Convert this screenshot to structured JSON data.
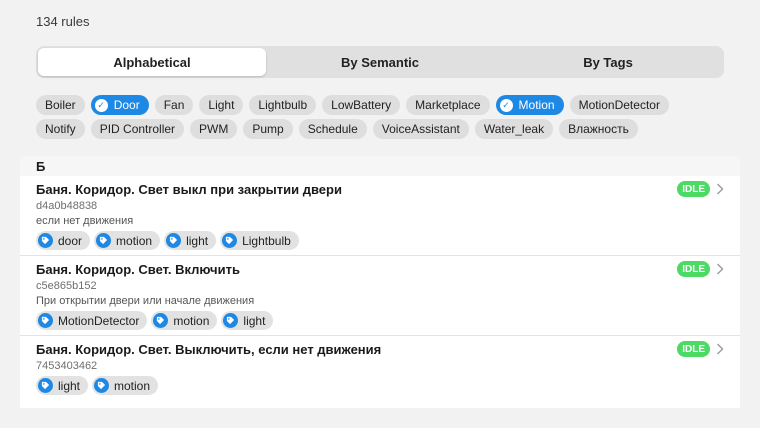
{
  "header": {
    "rule_count": "134 rules"
  },
  "segments": [
    {
      "label": "Alphabetical",
      "active": true
    },
    {
      "label": "By Semantic",
      "active": false
    },
    {
      "label": "By Tags",
      "active": false
    }
  ],
  "filter_chips": [
    {
      "label": "Boiler",
      "selected": false
    },
    {
      "label": "Door",
      "selected": true
    },
    {
      "label": "Fan",
      "selected": false
    },
    {
      "label": "Light",
      "selected": false
    },
    {
      "label": "Lightbulb",
      "selected": false
    },
    {
      "label": "LowBattery",
      "selected": false
    },
    {
      "label": "Marketplace",
      "selected": false
    },
    {
      "label": "Motion",
      "selected": true
    },
    {
      "label": "MotionDetector",
      "selected": false
    },
    {
      "label": "Notify",
      "selected": false
    },
    {
      "label": "PID Controller",
      "selected": false
    },
    {
      "label": "PWM",
      "selected": false
    },
    {
      "label": "Pump",
      "selected": false
    },
    {
      "label": "Schedule",
      "selected": false
    },
    {
      "label": "VoiceAssistant",
      "selected": false
    },
    {
      "label": "Water_leak",
      "selected": false
    },
    {
      "label": "Влажность",
      "selected": false
    }
  ],
  "section": {
    "letter": "Б"
  },
  "rules": [
    {
      "title": "Баня. Коридор. Свет выкл при закрытии двери",
      "id": "d4a0b48838",
      "description": "если нет движения",
      "tags": [
        "door",
        "motion",
        "light",
        "Lightbulb"
      ],
      "status": "IDLE"
    },
    {
      "title": "Баня. Коридор. Свет. Включить",
      "id": "c5e865b152",
      "description": "При открытии двери или начале движения",
      "tags": [
        "MotionDetector",
        "motion",
        "light"
      ],
      "status": "IDLE"
    },
    {
      "title": "Баня. Коридор. Свет. Выключить, если нет движения",
      "id": "7453403462",
      "description": "",
      "tags": [
        "light",
        "motion"
      ],
      "status": "IDLE"
    }
  ],
  "icons": {
    "check": "check-icon",
    "tag": "tag-icon",
    "chevron": "chevron-right-icon"
  },
  "colors": {
    "accent": "#1e88e5",
    "status_idle": "#4cd964",
    "chip_background": "#dedede",
    "background": "#f2f2f2"
  }
}
